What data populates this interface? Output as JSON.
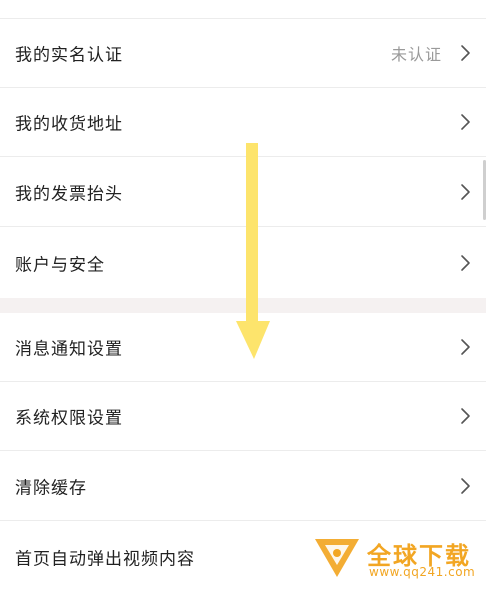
{
  "settings": {
    "group1": [
      {
        "label": "我的实名认证",
        "status": "未认证"
      },
      {
        "label": "我的收货地址",
        "status": ""
      },
      {
        "label": "我的发票抬头",
        "status": ""
      },
      {
        "label": "账户与安全",
        "status": ""
      }
    ],
    "group2": [
      {
        "label": "消息通知设置"
      },
      {
        "label": "系统权限设置"
      },
      {
        "label": "清除缓存"
      },
      {
        "label": "首页自动弹出视频内容"
      }
    ]
  },
  "icons": {
    "chevron": "chevron-right-icon",
    "annotation": "down-arrow-annotation",
    "watermark_logo": "watermark-logo-icon"
  },
  "watermark": {
    "title": "全球下载",
    "url": "www.qq241.com"
  },
  "colors": {
    "text_primary": "#222222",
    "text_secondary": "#9a9a9a",
    "divider": "#ececec",
    "section_gap": "#f5f1f1",
    "annotation_arrow": "#fde46c",
    "watermark": "#f2a623"
  }
}
